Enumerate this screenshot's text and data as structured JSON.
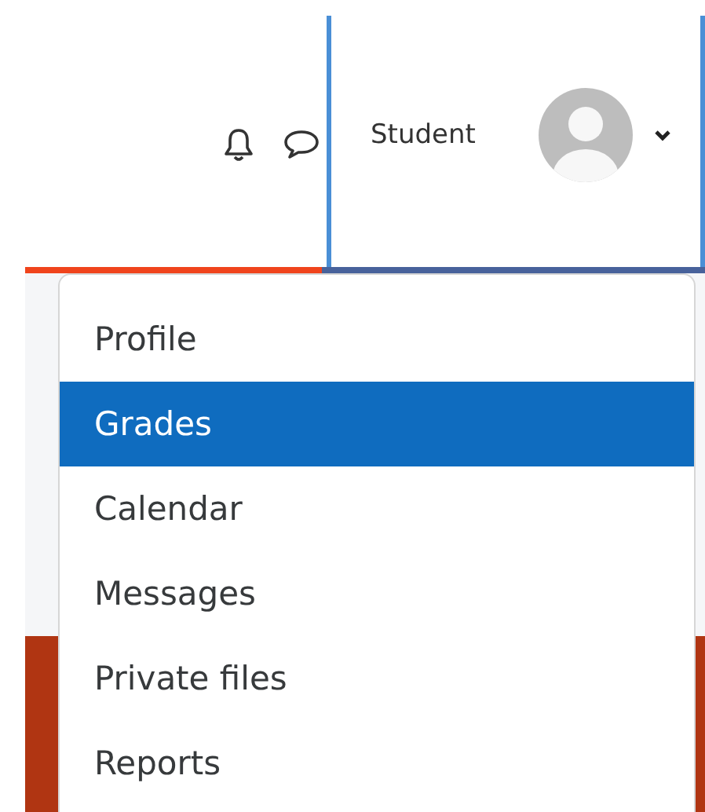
{
  "user_menu": {
    "name": "Student"
  },
  "dropdown": {
    "items": [
      {
        "label": "Profile",
        "selected": false
      },
      {
        "label": "Grades",
        "selected": true
      },
      {
        "label": "Calendar",
        "selected": false
      },
      {
        "label": "Messages",
        "selected": false
      },
      {
        "label": "Private files",
        "selected": false
      },
      {
        "label": "Reports",
        "selected": false
      }
    ]
  }
}
